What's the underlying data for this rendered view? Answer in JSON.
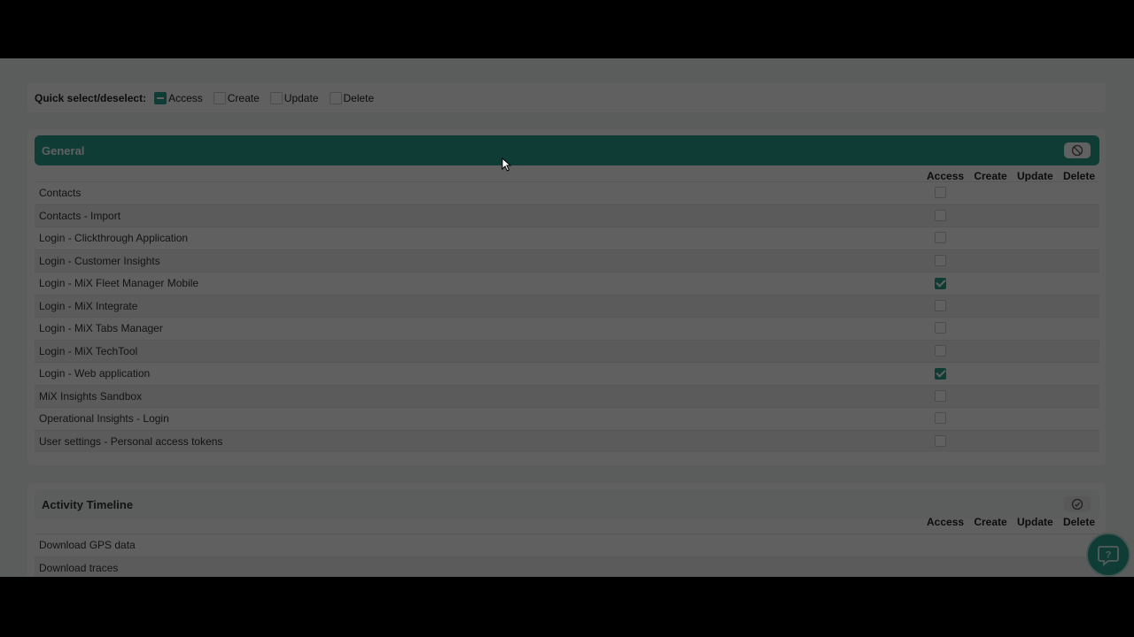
{
  "quick_select": {
    "label": "Quick select/deselect:",
    "options": [
      {
        "label": "Access",
        "state": "indeterminate"
      },
      {
        "label": "Create",
        "state": "unchecked"
      },
      {
        "label": "Update",
        "state": "unchecked"
      },
      {
        "label": "Delete",
        "state": "unchecked"
      }
    ]
  },
  "columns": [
    "Access",
    "Create",
    "Update",
    "Delete"
  ],
  "general": {
    "title": "General",
    "header_icon": "block-icon",
    "rows": [
      {
        "label": "Contacts",
        "access": false
      },
      {
        "label": "Contacts - Import",
        "access": false
      },
      {
        "label": "Login - Clickthrough Application",
        "access": false
      },
      {
        "label": "Login - Customer Insights",
        "access": false
      },
      {
        "label": "Login - MiX Fleet Manager Mobile",
        "access": true
      },
      {
        "label": "Login - MiX Integrate",
        "access": false
      },
      {
        "label": "Login - MiX Tabs Manager",
        "access": false
      },
      {
        "label": "Login - MiX TechTool",
        "access": false
      },
      {
        "label": "Login - Web application",
        "access": true
      },
      {
        "label": "MiX Insights Sandbox",
        "access": false
      },
      {
        "label": "Operational Insights - Login",
        "access": false
      },
      {
        "label": "User settings - Personal access tokens",
        "access": false
      }
    ]
  },
  "activity_timeline": {
    "title": "Activity Timeline",
    "header_icon": "check-circle-icon",
    "rows": [
      {
        "label": "Download GPS data"
      },
      {
        "label": "Download traces"
      }
    ]
  },
  "help_icon": "help-chat-icon",
  "colors": {
    "accent": "#2a9d8f",
    "overlay": "rgba(0,0,0,0.62)"
  }
}
